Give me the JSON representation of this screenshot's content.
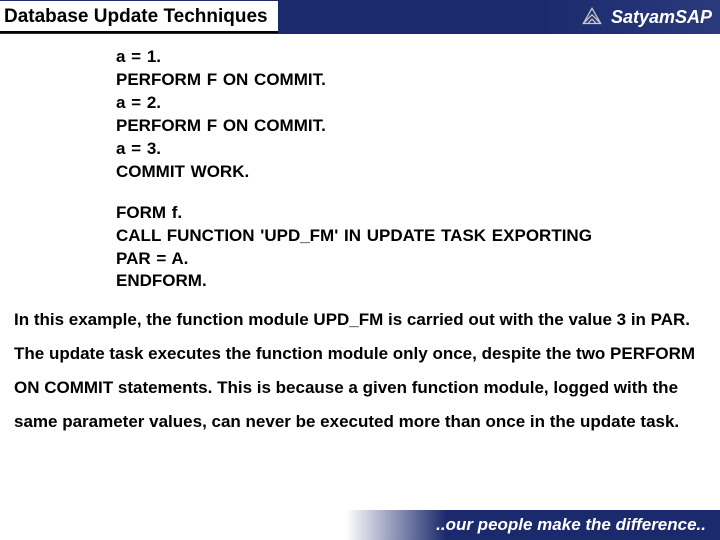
{
  "header": {
    "title": "Database Update Techniques",
    "brand_prefix": "Satyam",
    "brand_suffix": "SAP"
  },
  "code": {
    "block1": [
      "a = 1.",
      "PERFORM F ON COMMIT.",
      "a = 2.",
      "PERFORM F ON COMMIT.",
      "a = 3.",
      "COMMIT WORK."
    ],
    "block2": [
      "FORM f.",
      "CALL FUNCTION 'UPD_FM' IN UPDATE TASK EXPORTING",
      "PAR = A.",
      "ENDFORM."
    ]
  },
  "paragraph": "In this example, the function module UPD_FM is carried out with the value 3 in PAR. The update task executes the function module only once, despite the two PERFORM ON COMMIT statements. This is because a given function module, logged with the same parameter values, can never be executed more than once in the update task.",
  "footer": {
    "tagline": "..our people make the difference.."
  }
}
